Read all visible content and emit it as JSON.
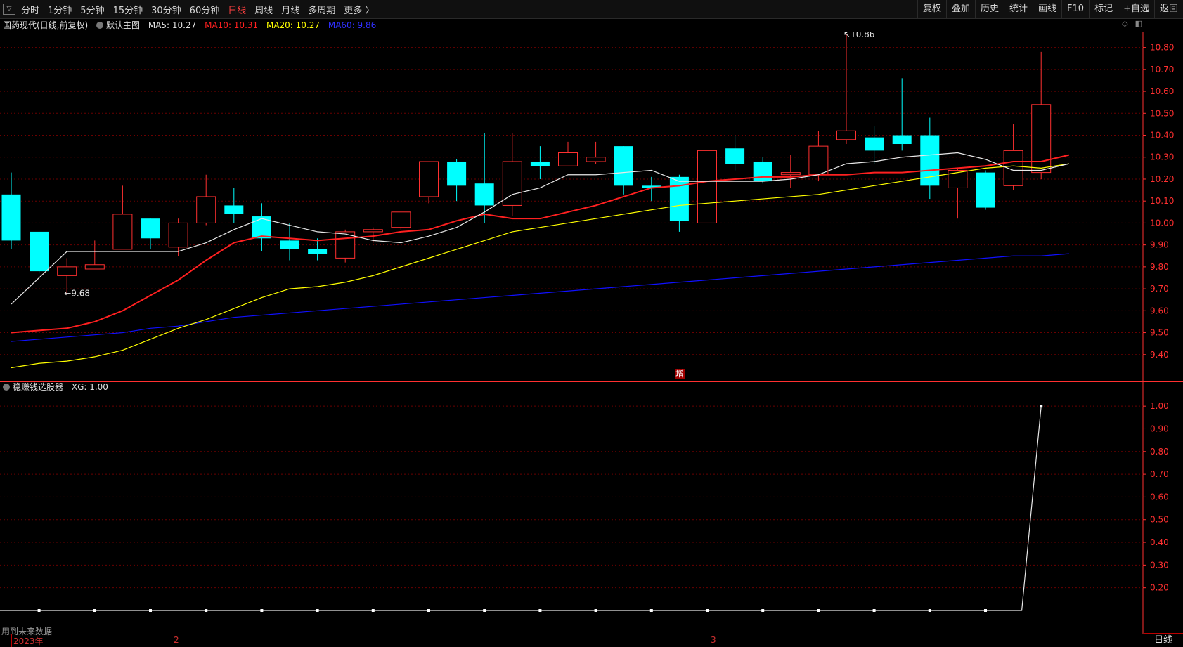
{
  "toolbar": {
    "periods": [
      "分时",
      "1分钟",
      "5分钟",
      "15分钟",
      "30分钟",
      "60分钟",
      "日线",
      "周线",
      "月线",
      "多周期",
      "更多 〉"
    ],
    "active_period": "日线",
    "actions": [
      "复权",
      "叠加",
      "历史",
      "统计",
      "画线",
      "F10",
      "标记",
      "+自选",
      "返回"
    ]
  },
  "main_legend": {
    "stock": "国药现代(日线,前复权)",
    "main_label": "默认主图",
    "ma5": "MA5: 10.27",
    "ma10": "MA10: 10.31",
    "ma20": "MA20: 10.27",
    "ma60": "MA60: 9.86"
  },
  "indicator_legend": {
    "name": "稳赚钱选股器",
    "value": "XG: 1.00"
  },
  "increase_marker": "增",
  "future_note": "用到未来数据",
  "period_label": "日线",
  "dates": [
    {
      "label": "2023年",
      "pos": 0.01
    },
    {
      "label": "2",
      "pos": 0.15
    },
    {
      "label": "3",
      "pos": 0.62
    }
  ],
  "colors": {
    "up": "#ff3030",
    "down": "#00ffff",
    "ma5": "#e8e8e8",
    "ma10": "#ff2020",
    "ma20": "#ffff00",
    "ma60": "#1010ff",
    "grid": "#6a0000",
    "axis": "#ff3030"
  },
  "chart_data": [
    {
      "type": "candlestick",
      "title": "国药现代(日线,前复权)",
      "ylim": [
        9.3,
        10.85
      ],
      "y_ticks": [
        10.8,
        10.7,
        10.6,
        10.5,
        10.4,
        10.3,
        10.2,
        10.1,
        10.0,
        9.9,
        9.8,
        9.7,
        9.6,
        9.5,
        9.4
      ],
      "annotations": [
        {
          "text": "9.68",
          "index": 2,
          "value": 9.68
        },
        {
          "text": "10.86",
          "index": 30,
          "value": 10.86
        }
      ],
      "candles": [
        {
          "o": 10.13,
          "c": 9.92,
          "h": 10.23,
          "l": 9.88
        },
        {
          "o": 9.96,
          "c": 9.78,
          "h": 9.96,
          "l": 9.77
        },
        {
          "o": 9.76,
          "c": 9.8,
          "h": 9.84,
          "l": 9.68
        },
        {
          "o": 9.79,
          "c": 9.81,
          "h": 9.92,
          "l": 9.79
        },
        {
          "o": 9.88,
          "c": 10.04,
          "h": 10.17,
          "l": 9.88
        },
        {
          "o": 10.02,
          "c": 9.93,
          "h": 10.02,
          "l": 9.88
        },
        {
          "o": 9.89,
          "c": 10.0,
          "h": 10.02,
          "l": 9.85
        },
        {
          "o": 10.0,
          "c": 10.12,
          "h": 10.22,
          "l": 9.99
        },
        {
          "o": 10.08,
          "c": 10.04,
          "h": 10.16,
          "l": 10.0
        },
        {
          "o": 10.03,
          "c": 9.93,
          "h": 10.09,
          "l": 9.87
        },
        {
          "o": 9.92,
          "c": 9.88,
          "h": 10.0,
          "l": 9.83
        },
        {
          "o": 9.88,
          "c": 9.86,
          "h": 9.93,
          "l": 9.83
        },
        {
          "o": 9.84,
          "c": 9.96,
          "h": 9.97,
          "l": 9.82
        },
        {
          "o": 9.96,
          "c": 9.97,
          "h": 9.98,
          "l": 9.91
        },
        {
          "o": 9.98,
          "c": 10.05,
          "h": 10.05,
          "l": 9.97
        },
        {
          "o": 10.12,
          "c": 10.28,
          "h": 10.28,
          "l": 10.09
        },
        {
          "o": 10.28,
          "c": 10.17,
          "h": 10.29,
          "l": 10.1
        },
        {
          "o": 10.18,
          "c": 10.08,
          "h": 10.41,
          "l": 10.0
        },
        {
          "o": 10.08,
          "c": 10.28,
          "h": 10.41,
          "l": 10.03
        },
        {
          "o": 10.28,
          "c": 10.26,
          "h": 10.35,
          "l": 10.2
        },
        {
          "o": 10.26,
          "c": 10.32,
          "h": 10.37,
          "l": 10.26
        },
        {
          "o": 10.28,
          "c": 10.3,
          "h": 10.37,
          "l": 10.27
        },
        {
          "o": 10.35,
          "c": 10.17,
          "h": 10.35,
          "l": 10.13
        },
        {
          "o": 10.17,
          "c": 10.16,
          "h": 10.21,
          "l": 10.1
        },
        {
          "o": 10.21,
          "c": 10.01,
          "h": 10.22,
          "l": 9.96
        },
        {
          "o": 10.0,
          "c": 10.33,
          "h": 10.33,
          "l": 10.0
        },
        {
          "o": 10.34,
          "c": 10.27,
          "h": 10.4,
          "l": 10.24
        },
        {
          "o": 10.28,
          "c": 10.19,
          "h": 10.3,
          "l": 10.18
        },
        {
          "o": 10.22,
          "c": 10.23,
          "h": 10.31,
          "l": 10.16
        },
        {
          "o": 10.22,
          "c": 10.35,
          "h": 10.42,
          "l": 10.19
        },
        {
          "o": 10.38,
          "c": 10.42,
          "h": 10.86,
          "l": 10.36
        },
        {
          "o": 10.39,
          "c": 10.33,
          "h": 10.44,
          "l": 10.27
        },
        {
          "o": 10.4,
          "c": 10.36,
          "h": 10.66,
          "l": 10.33
        },
        {
          "o": 10.4,
          "c": 10.17,
          "h": 10.48,
          "l": 10.11
        },
        {
          "o": 10.16,
          "c": 10.24,
          "h": 10.25,
          "l": 10.02
        },
        {
          "o": 10.23,
          "c": 10.07,
          "h": 10.24,
          "l": 10.06
        },
        {
          "o": 10.17,
          "c": 10.33,
          "h": 10.45,
          "l": 10.15
        },
        {
          "o": 10.23,
          "c": 10.54,
          "h": 10.78,
          "l": 10.2
        }
      ],
      "ma5": [
        9.63,
        9.75,
        9.87,
        9.87,
        9.87,
        9.87,
        9.87,
        9.91,
        9.97,
        10.02,
        9.99,
        9.96,
        9.95,
        9.92,
        9.91,
        9.94,
        9.98,
        10.05,
        10.13,
        10.16,
        10.22,
        10.22,
        10.23,
        10.24,
        10.19,
        10.19,
        10.19,
        10.19,
        10.2,
        10.22,
        10.27,
        10.28,
        10.3,
        10.31,
        10.32,
        10.29,
        10.24,
        10.24,
        10.27
      ],
      "ma10": [
        9.5,
        9.51,
        9.52,
        9.55,
        9.6,
        9.67,
        9.74,
        9.83,
        9.91,
        9.94,
        9.93,
        9.92,
        9.93,
        9.94,
        9.96,
        9.97,
        10.01,
        10.04,
        10.02,
        10.02,
        10.05,
        10.08,
        10.12,
        10.16,
        10.17,
        10.19,
        10.2,
        10.21,
        10.21,
        10.22,
        10.22,
        10.23,
        10.23,
        10.24,
        10.25,
        10.26,
        10.28,
        10.28,
        10.31
      ],
      "ma20": [
        9.34,
        9.36,
        9.37,
        9.39,
        9.42,
        9.47,
        9.52,
        9.56,
        9.61,
        9.66,
        9.7,
        9.71,
        9.73,
        9.76,
        9.8,
        9.84,
        9.88,
        9.92,
        9.96,
        9.98,
        10.0,
        10.02,
        10.04,
        10.06,
        10.08,
        10.09,
        10.1,
        10.11,
        10.12,
        10.13,
        10.15,
        10.17,
        10.19,
        10.21,
        10.23,
        10.25,
        10.26,
        10.25,
        10.27
      ],
      "ma60": [
        9.46,
        9.47,
        9.48,
        9.49,
        9.5,
        9.52,
        9.53,
        9.55,
        9.57,
        9.58,
        9.59,
        9.6,
        9.61,
        9.62,
        9.63,
        9.64,
        9.65,
        9.66,
        9.67,
        9.68,
        9.69,
        9.7,
        9.71,
        9.72,
        9.73,
        9.74,
        9.75,
        9.76,
        9.77,
        9.78,
        9.79,
        9.8,
        9.81,
        9.82,
        9.83,
        9.84,
        9.85,
        9.85,
        9.86
      ]
    },
    {
      "type": "line",
      "title": "稳赚钱选股器",
      "series": [
        {
          "name": "XG",
          "values": [
            0,
            0,
            0,
            0,
            0,
            0,
            0,
            0,
            0,
            0,
            0,
            0,
            0,
            0,
            0,
            0,
            0,
            0,
            0,
            0,
            0,
            0,
            0,
            0,
            0,
            0,
            0,
            0,
            0,
            0,
            0,
            0,
            0,
            0,
            0,
            0,
            0,
            1
          ]
        }
      ],
      "marker_indices": [
        1,
        3,
        5,
        7,
        9,
        11,
        13,
        15,
        17,
        19,
        21,
        23,
        25,
        27,
        29,
        31,
        33,
        35
      ],
      "ylim": [
        0.1,
        1.05
      ],
      "y_ticks": [
        1.0,
        0.9,
        0.8,
        0.7,
        0.6,
        0.5,
        0.4,
        0.3,
        0.2
      ]
    }
  ]
}
